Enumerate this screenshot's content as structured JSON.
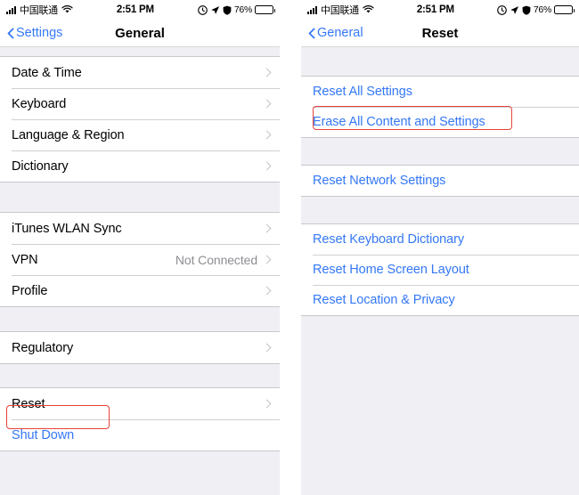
{
  "status_bar": {
    "carrier": "中国联通",
    "time": "2:51 PM",
    "battery_percent": "76%",
    "icons": [
      "signal-bars-icon",
      "wifi-icon",
      "alarm-icon",
      "location-arrow-icon",
      "vpn-shield-icon",
      "battery-icon"
    ]
  },
  "left_screen": {
    "nav": {
      "back_label": "Settings",
      "title": "General"
    },
    "groups": [
      {
        "rows": [
          {
            "label": "Date & Time",
            "value": "",
            "accessory": "chevron-right-icon",
            "style": "default"
          },
          {
            "label": "Keyboard",
            "value": "",
            "accessory": "chevron-right-icon",
            "style": "default"
          },
          {
            "label": "Language & Region",
            "value": "",
            "accessory": "chevron-right-icon",
            "style": "default"
          },
          {
            "label": "Dictionary",
            "value": "",
            "accessory": "chevron-right-icon",
            "style": "default"
          }
        ]
      },
      {
        "rows": [
          {
            "label": "iTunes WLAN Sync",
            "value": "",
            "accessory": "chevron-right-icon",
            "style": "default"
          },
          {
            "label": "VPN",
            "value": "Not Connected",
            "accessory": "chevron-right-icon",
            "style": "default"
          },
          {
            "label": "Profile",
            "value": "",
            "accessory": "chevron-right-icon",
            "style": "default"
          }
        ]
      },
      {
        "rows": [
          {
            "label": "Regulatory",
            "value": "",
            "accessory": "chevron-right-icon",
            "style": "default"
          }
        ]
      },
      {
        "rows": [
          {
            "label": "Reset",
            "value": "",
            "accessory": "chevron-right-icon",
            "style": "default"
          },
          {
            "label": "Shut Down",
            "value": "",
            "accessory": "none",
            "style": "blue"
          }
        ]
      }
    ]
  },
  "right_screen": {
    "nav": {
      "back_label": "General",
      "title": "Reset"
    },
    "groups": [
      {
        "rows": [
          {
            "label": "Reset All Settings",
            "value": "",
            "accessory": "none",
            "style": "blue"
          },
          {
            "label": "Erase All Content and Settings",
            "value": "",
            "accessory": "none",
            "style": "blue"
          }
        ]
      },
      {
        "rows": [
          {
            "label": "Reset Network Settings",
            "value": "",
            "accessory": "none",
            "style": "blue"
          }
        ]
      },
      {
        "rows": [
          {
            "label": "Reset Keyboard Dictionary",
            "value": "",
            "accessory": "none",
            "style": "blue"
          },
          {
            "label": "Reset Home Screen Layout",
            "value": "",
            "accessory": "none",
            "style": "blue"
          },
          {
            "label": "Reset Location & Privacy",
            "value": "",
            "accessory": "none",
            "style": "blue"
          }
        ]
      }
    ]
  },
  "annotations": {
    "highlight_color": "#e8423a",
    "boxes": [
      {
        "target": "Reset",
        "screen": "left"
      },
      {
        "target": "Erase All Content and Settings",
        "screen": "right"
      }
    ]
  },
  "theme": {
    "accent_blue": "#3478f6",
    "list_background": "#efeff4",
    "separator": "#c8c7cc",
    "secondary_text": "#8e8e93"
  }
}
